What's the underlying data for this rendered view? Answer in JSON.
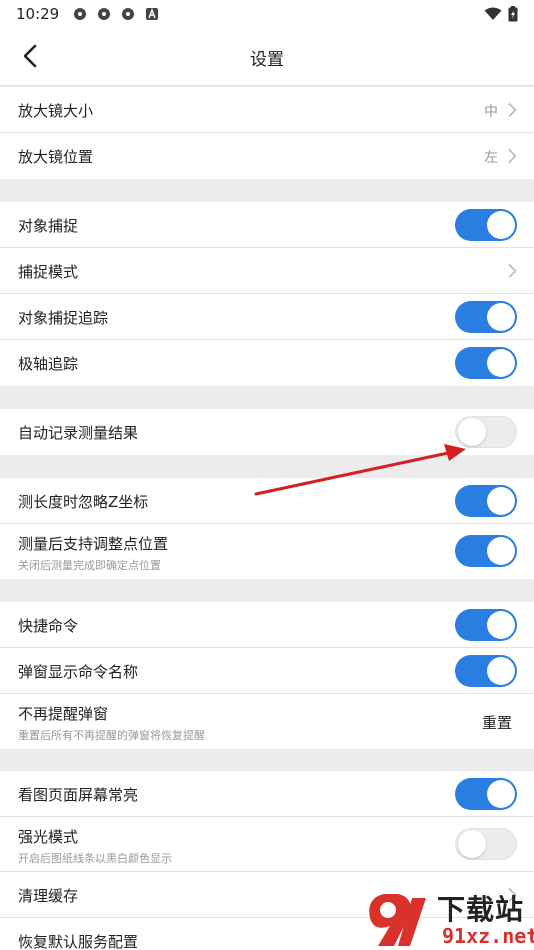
{
  "status_bar": {
    "time": "10:29"
  },
  "header": {
    "title": "设置"
  },
  "sections": [
    {
      "items": [
        {
          "label": "放大镜大小",
          "value": "中"
        },
        {
          "label": "放大镜位置",
          "value": "左"
        }
      ]
    },
    {
      "items": [
        {
          "label": "对象捕捉",
          "toggle": "on"
        },
        {
          "label": "捕捉模式"
        },
        {
          "label": "对象捕捉追踪",
          "toggle": "on"
        },
        {
          "label": "极轴追踪",
          "toggle": "on"
        }
      ]
    },
    {
      "items": [
        {
          "label": "自动记录测量结果",
          "toggle": "off"
        }
      ]
    },
    {
      "items": [
        {
          "label": "测长度时忽略Z坐标",
          "toggle": "on"
        },
        {
          "label": "测量后支持调整点位置",
          "sublabel": "关闭后测量完成即确定点位置",
          "toggle": "on"
        }
      ]
    },
    {
      "items": [
        {
          "label": "快捷命令",
          "toggle": "on"
        },
        {
          "label": "弹窗显示命令名称",
          "toggle": "on"
        },
        {
          "label": "不再提醒弹窗",
          "sublabel": "重置后所有不再提醒的弹窗将恢复提醒",
          "action": "重置"
        }
      ]
    },
    {
      "items": [
        {
          "label": "看图页面屏幕常亮",
          "toggle": "on"
        },
        {
          "label": "强光模式",
          "sublabel": "开启后图纸线条以黑白颜色显示",
          "toggle": "off"
        },
        {
          "label": "清理缓存"
        },
        {
          "label": "恢复默认服务配置"
        }
      ]
    }
  ],
  "watermark": {
    "name": "下载站",
    "url": "91xz.net"
  },
  "colors": {
    "toggle_on": "#2a7de1",
    "annotation_arrow": "#d42020",
    "watermark_red": "#d9312b"
  }
}
